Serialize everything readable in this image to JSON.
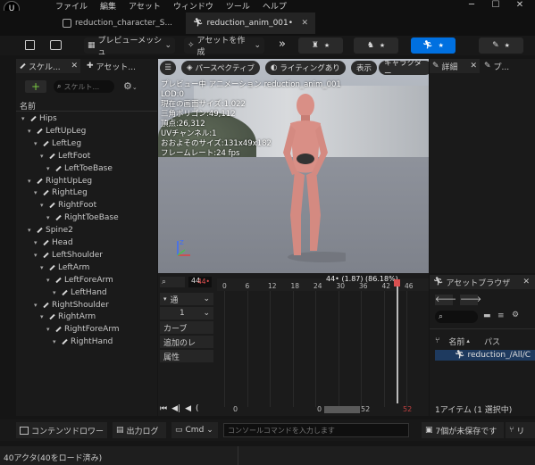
{
  "menu": [
    "ファイル",
    "編集",
    "アセット",
    "ウィンドウ",
    "ツール",
    "ヘルプ"
  ],
  "tabs": [
    {
      "label": "reduction_character_S...",
      "active": false
    },
    {
      "label": "reduction_anim_001•",
      "active": true
    }
  ],
  "toolbar": {
    "preview_mesh": "プレビューメッシュ",
    "create_asset": "アセットを作成",
    "more": "»"
  },
  "left_panel": {
    "tabs": [
      "スケル...",
      "アセット..."
    ],
    "search_placeholder": "スケルト...",
    "column_header": "名前",
    "bones": [
      {
        "name": "Hips",
        "depth": 0
      },
      {
        "name": "LeftUpLeg",
        "depth": 1
      },
      {
        "name": "LeftLeg",
        "depth": 2
      },
      {
        "name": "LeftFoot",
        "depth": 3
      },
      {
        "name": "LeftToeBase",
        "depth": 4
      },
      {
        "name": "RightUpLeg",
        "depth": 1
      },
      {
        "name": "RightLeg",
        "depth": 2
      },
      {
        "name": "RightFoot",
        "depth": 3
      },
      {
        "name": "RightToeBase",
        "depth": 4
      },
      {
        "name": "Spine2",
        "depth": 1
      },
      {
        "name": "Head",
        "depth": 2
      },
      {
        "name": "LeftShoulder",
        "depth": 2
      },
      {
        "name": "LeftArm",
        "depth": 3
      },
      {
        "name": "LeftForeArm",
        "depth": 4
      },
      {
        "name": "LeftHand",
        "depth": 5
      },
      {
        "name": "RightShoulder",
        "depth": 2
      },
      {
        "name": "RightArm",
        "depth": 3
      },
      {
        "name": "RightForeArm",
        "depth": 4
      },
      {
        "name": "RightHand",
        "depth": 5
      }
    ]
  },
  "viewport": {
    "buttons": [
      "パースペクティブ",
      "ライティングあり",
      "表示",
      "キャラクター"
    ],
    "overlay_lines": [
      "プレビュー中 アニメーション reduction_anim_001",
      "LOD:0",
      "現在の画面サイズ:1.022",
      "三角ポリゴン:49,112",
      "頂点:26,312",
      "UVチャンネル:1",
      "おおよそのサイズ:131x49x182",
      "フレームレート:24 fps"
    ]
  },
  "timeline": {
    "frame_field": "44",
    "frame_marker": "44•",
    "playhead_label": "44• (1.87) (86.18%)",
    "ruler": [
      "0",
      "6",
      "12",
      "18",
      "24",
      "30",
      "36",
      "42",
      "46"
    ],
    "left_items": [
      "通"
    ],
    "count_value": "1",
    "curve_label": "カーブ",
    "add_label": "追加のレ",
    "attr_label": "属性",
    "range_start": "0",
    "range_view_start": "0",
    "range_view_end": "52",
    "range_end": "52"
  },
  "details": {
    "tabs": [
      "詳細",
      "プ..."
    ]
  },
  "asset_browser": {
    "title": "アセットブラウザ",
    "column_name": "名前",
    "column_path": "パス",
    "asset_name": "reduction_/All/C",
    "footer": "1アイテム (1 選択中)"
  },
  "bottombar": {
    "content_drawer": "コンテンツドロワー",
    "output_log": "出力ログ",
    "cmd": "Cmd",
    "console_placeholder": "コンソールコマンドを入力します",
    "unsaved": "7個が未保存です",
    "extra": "リ"
  },
  "status": {
    "actors": "40アクタ(40をロード済み)"
  },
  "colors": {
    "accent": "#0070e0",
    "playhead": "#ff5050",
    "selection": "#1e3a5f"
  }
}
